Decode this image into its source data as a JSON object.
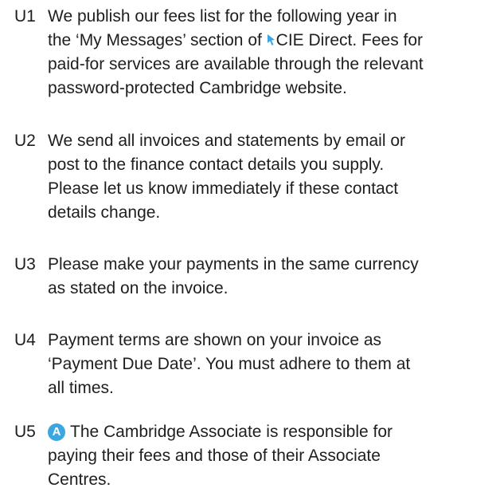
{
  "clauses": [
    {
      "number": "U1",
      "lines": [
        "We publish our fees list for the following year in",
        "the ‘My Messages’ section of ",
        "CIE Direct. Fees for",
        "paid-for services are available through the relevant",
        "password-protected Cambridge website."
      ],
      "icon": "cursor-arrow-icon"
    },
    {
      "number": "U2",
      "lines": [
        "We send all invoices and statements by email or",
        "post to the finance contact details you supply.",
        "Please let us know immediately if these contact",
        "details change."
      ]
    },
    {
      "number": "U3",
      "lines": [
        "Please make your payments in the same currency",
        "as stated on the invoice."
      ]
    },
    {
      "number": "U4",
      "lines": [
        "Payment terms are shown on your invoice as",
        "‘Payment Due Date’. You must adhere to them at",
        "all times."
      ]
    },
    {
      "number": "U5",
      "badge": "A",
      "lines": [
        "The Cambridge Associate is responsible for",
        "paying their fees and those of their Associate",
        "Centres."
      ]
    }
  ],
  "colors": {
    "text": "#1e1e1e",
    "accent": "#3aa7e0"
  }
}
